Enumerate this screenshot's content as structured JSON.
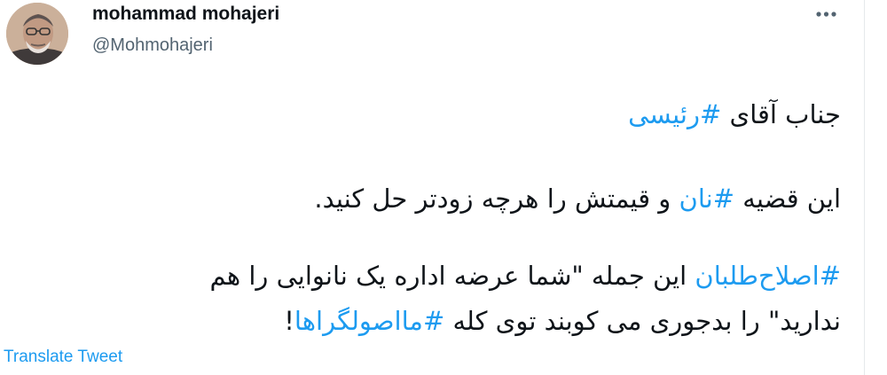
{
  "author": {
    "display_name": "mohammad mohajeri",
    "handle": "@Mohmohajeri"
  },
  "more_icon": "more-horizontal-icon",
  "tweet": {
    "line1": {
      "text": "جناب آقای ",
      "hashtag": "#رئیسی"
    },
    "line2": {
      "before": "این قضیه ",
      "hashtag": "#نان",
      "after": " و قیمتش  را هرچه زودتر حل کنید."
    },
    "line3": {
      "hashtag": "#اصلاح‌طلبان",
      "after": " این جمله \"شما عرضه اداره یک نانوایی را هم"
    },
    "line4": {
      "before": "ندارید\" را بدجوری می کوبند توی کله ",
      "hashtag": "#مااصولگراها",
      "after": "!"
    }
  },
  "translate_label": "Translate Tweet",
  "colors": {
    "accent": "#1d9bf0",
    "text": "#0f1419",
    "secondary": "#536471"
  }
}
